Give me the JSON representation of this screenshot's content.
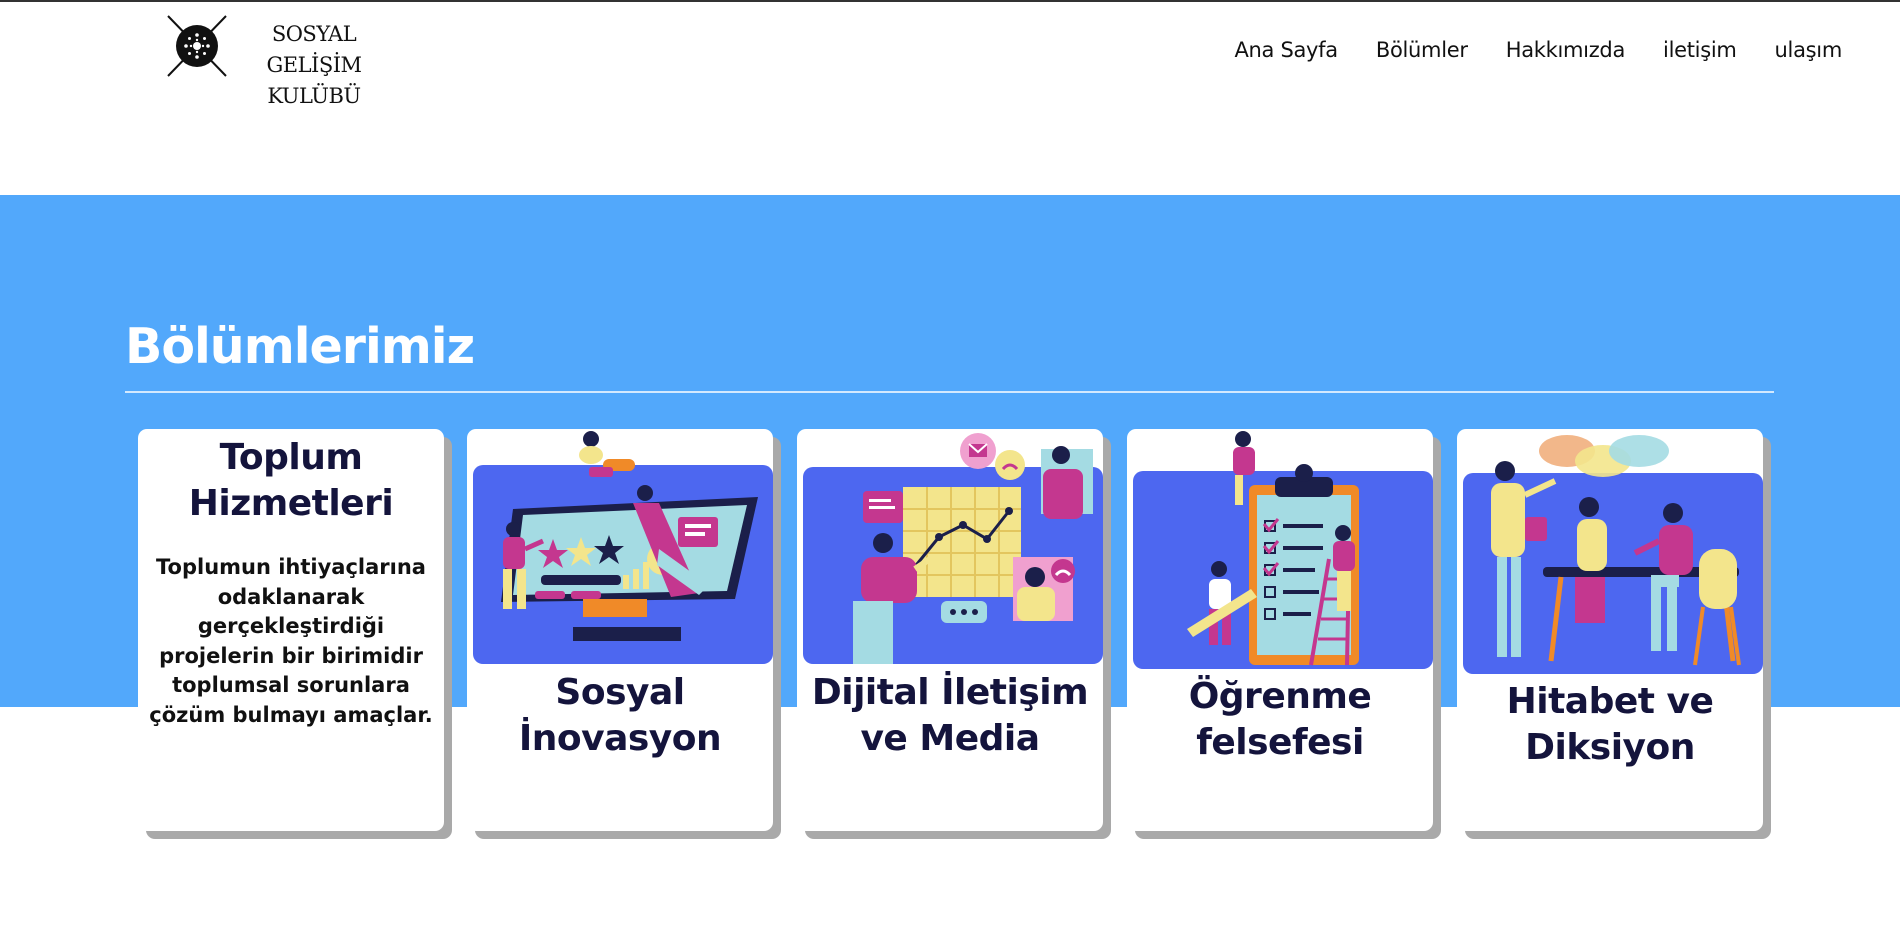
{
  "brand": {
    "logo_lines": [
      "SOSYAL GELİŞİM",
      "KULÜBÜ"
    ]
  },
  "nav": [
    "Ana Sayfa",
    "Bölümler",
    "Hakkımızda",
    "iletişim",
    "ulaşım"
  ],
  "colors": {
    "band": "#52a8fb",
    "illustration_bg": "#4d67f0",
    "title_text": "#14143c",
    "accent_magenta": "#c4378f",
    "accent_yellow": "#f3e58c",
    "accent_orange": "#f08a28"
  },
  "section": {
    "title": "Bölümlerimiz"
  },
  "cards": [
    {
      "title_lines": [
        "Toplum",
        "Hizmetleri"
      ],
      "description_lines": [
        "Toplumun ihtiyaçlarına",
        "odaklanarak",
        "gerçekleştirdiği",
        "projelerin bir birimidir",
        "toplumsal sorunlara",
        "çözüm bulmayı amaçlar."
      ]
    },
    {
      "title_lines": [
        "Sosyal",
        "İnovasyon"
      ],
      "image_icon": "dashboard-teamwork-illustration"
    },
    {
      "title_lines": [
        "Dijital İletişim",
        "ve Media"
      ],
      "image_icon": "digital-communication-illustration"
    },
    {
      "title_lines": [
        "Öğrenme",
        "felsefesi"
      ],
      "image_icon": "checklist-clipboard-illustration"
    },
    {
      "title_lines": [
        "Hitabet ve",
        "Diksiyon"
      ],
      "image_icon": "team-discussion-illustration"
    }
  ]
}
